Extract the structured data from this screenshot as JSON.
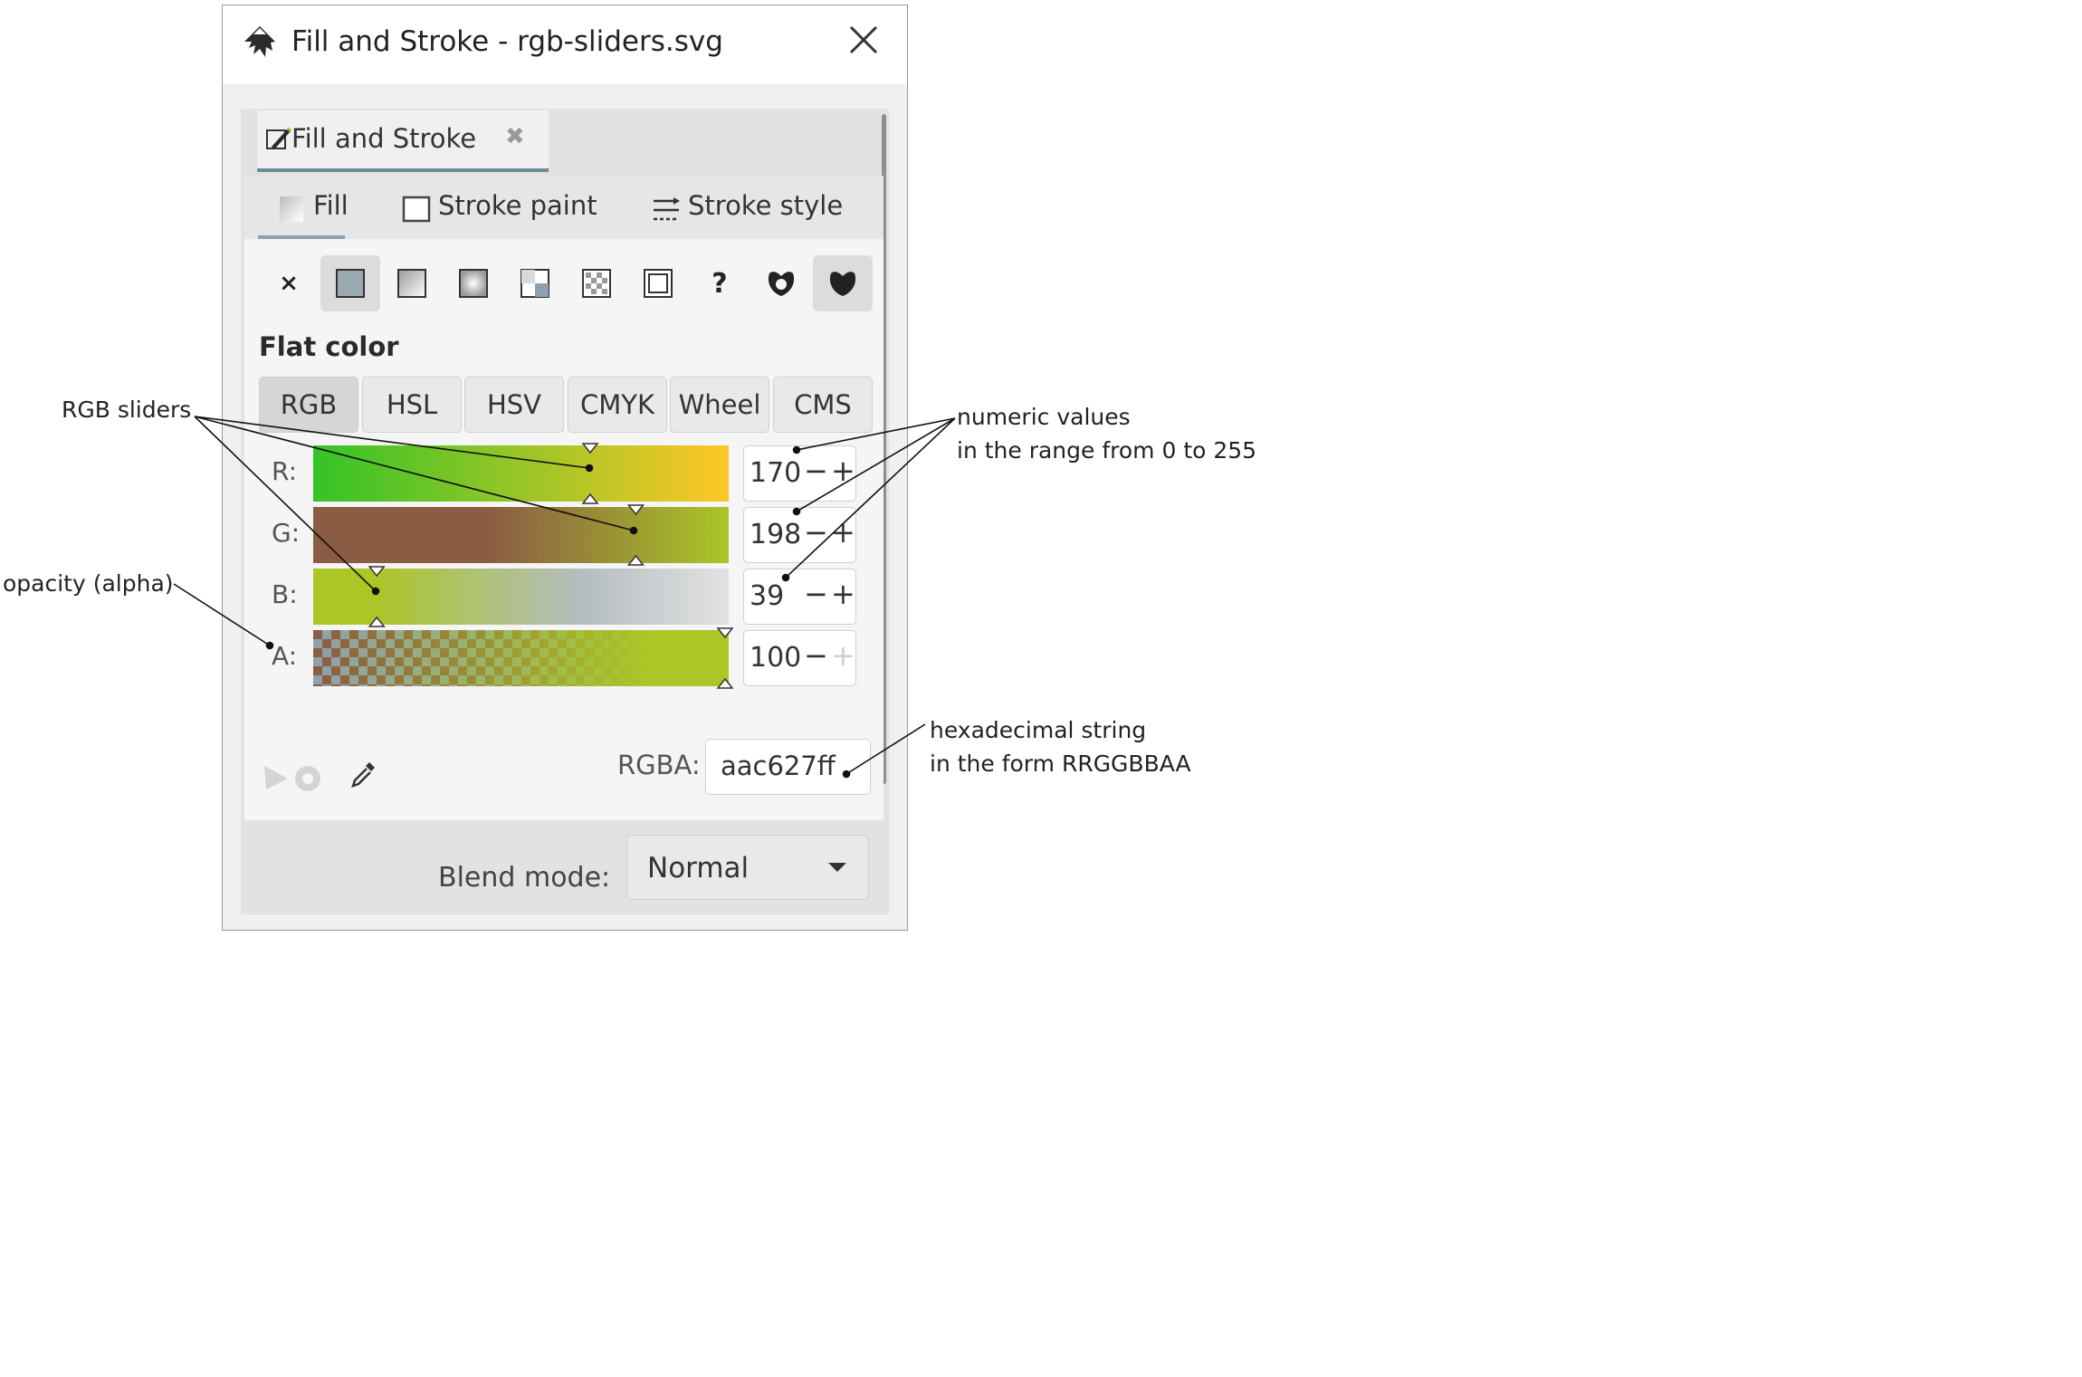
{
  "window": {
    "title": "Fill and Stroke - rgb-sliders.svg"
  },
  "dock": {
    "tab_label": "Fill and Stroke"
  },
  "panel_tabs": {
    "fill": "Fill",
    "stroke_paint": "Stroke paint",
    "stroke_style": "Stroke style"
  },
  "paint_types": [
    {
      "name": "no-paint",
      "glyph": "×"
    },
    {
      "name": "flat-color",
      "selected": true
    },
    {
      "name": "linear-gradient"
    },
    {
      "name": "radial-gradient"
    },
    {
      "name": "mesh-gradient"
    },
    {
      "name": "pattern"
    },
    {
      "name": "swatch"
    },
    {
      "name": "unset",
      "glyph": "?"
    },
    {
      "name": "fill-rule-evenodd"
    },
    {
      "name": "fill-rule-nonzero",
      "selected": true
    }
  ],
  "flat_color_label": "Flat color",
  "modes": [
    "RGB",
    "HSL",
    "HSV",
    "CMYK",
    "Wheel",
    "CMS"
  ],
  "selected_mode": "RGB",
  "channels": [
    {
      "label": "R:",
      "value": "170"
    },
    {
      "label": "G:",
      "value": "198"
    },
    {
      "label": "B:",
      "value": "39"
    },
    {
      "label": "A:",
      "value": "100"
    }
  ],
  "spin": {
    "minus": "−",
    "plus": "+"
  },
  "rgba": {
    "label": "RGBA:",
    "value": "aac627ff"
  },
  "blend": {
    "label": "Blend mode:",
    "value": "Normal"
  },
  "annotations": {
    "rgb_sliders": "RGB sliders",
    "opacity": "opacity (alpha)",
    "numeric_line1": "numeric values",
    "numeric_line2": "in the range from 0 to 255",
    "hex_line1": "hexadecimal string",
    "hex_line2": "in the form RRGGBBAA"
  },
  "colors": {
    "current": "#aac627",
    "red_slider_start": "#33c427",
    "green_slider_start": "#8a5c44",
    "blue_slider_end": "#e2e2e2"
  }
}
